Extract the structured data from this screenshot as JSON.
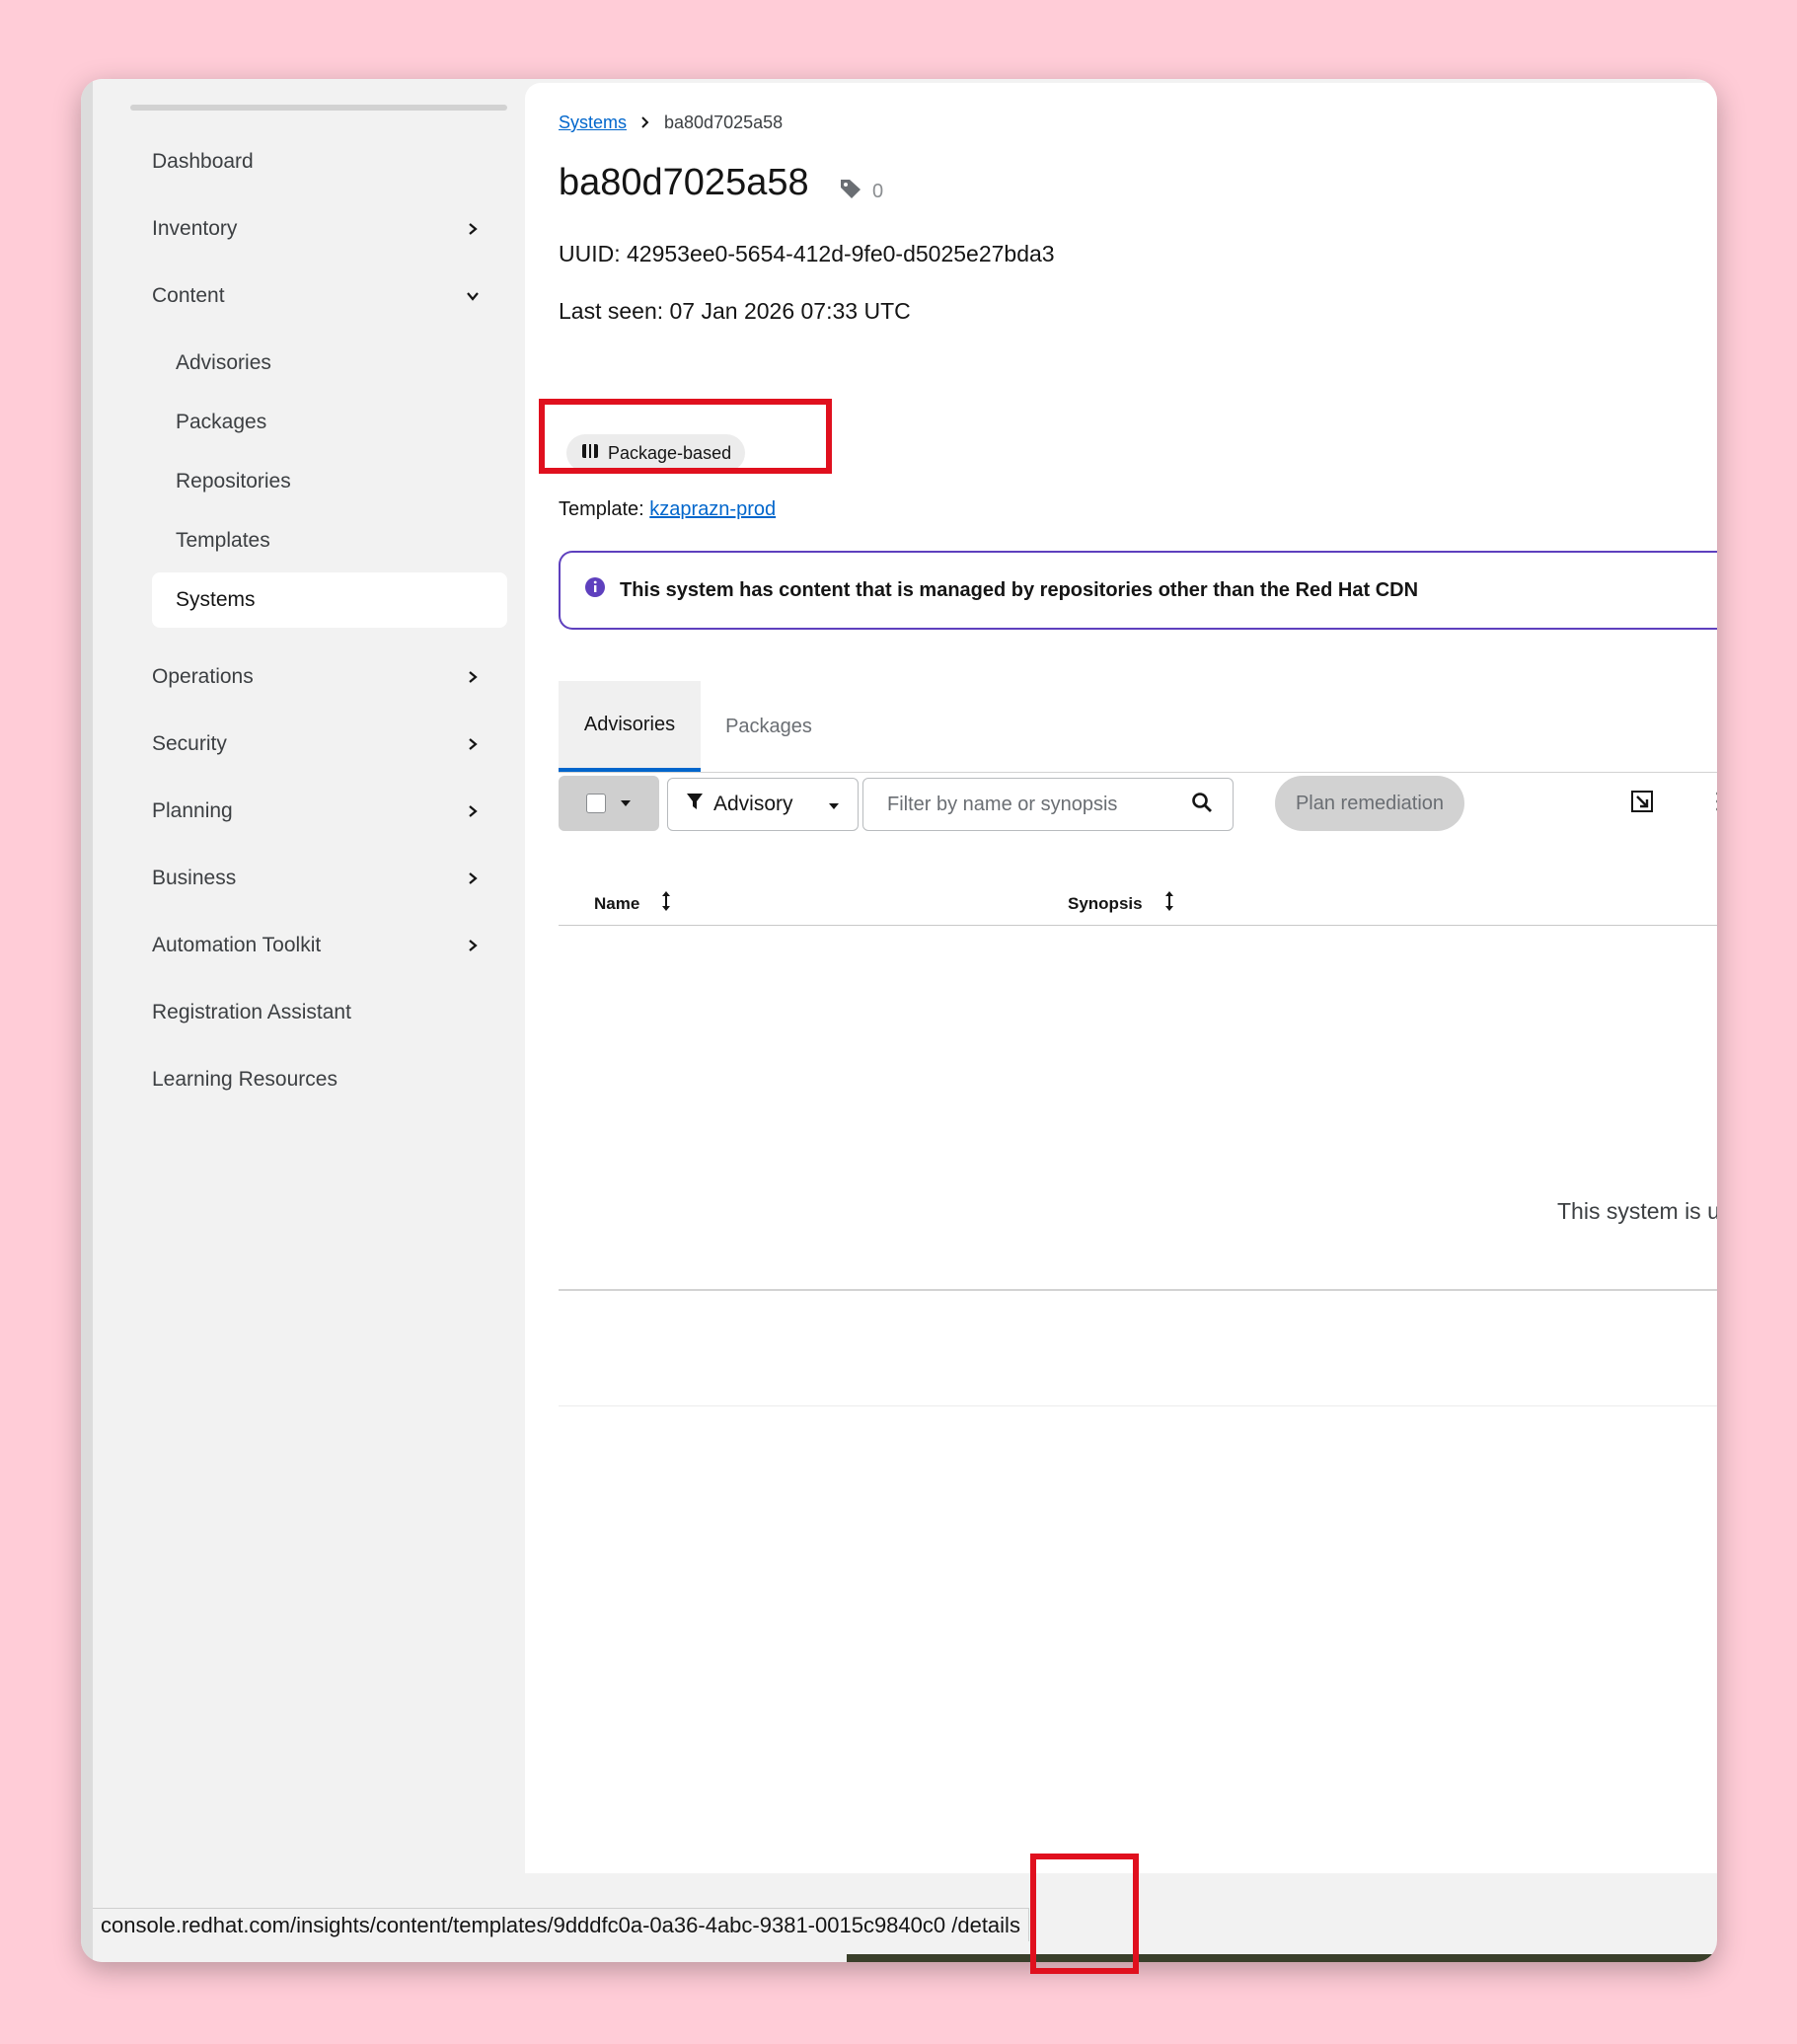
{
  "sidebar": {
    "items": [
      {
        "label": "Dashboard"
      },
      {
        "label": "Inventory"
      },
      {
        "label": "Content"
      },
      {
        "label": "Advisories"
      },
      {
        "label": "Packages"
      },
      {
        "label": "Repositories"
      },
      {
        "label": "Templates"
      },
      {
        "label": "Systems"
      },
      {
        "label": "Operations"
      },
      {
        "label": "Security"
      },
      {
        "label": "Planning"
      },
      {
        "label": "Business"
      },
      {
        "label": "Automation Toolkit"
      },
      {
        "label": "Registration Assistant"
      },
      {
        "label": "Learning Resources"
      }
    ]
  },
  "breadcrumb": {
    "parent": "Systems",
    "current": "ba80d7025a58"
  },
  "system": {
    "title": "ba80d7025a58",
    "tag_count": "0",
    "uuid": "UUID: 42953ee0-5654-412d-9fe0-d5025e27bda3",
    "last_seen": "Last seen: 07 Jan 2026 07:33 UTC",
    "type_label": "Package-based",
    "template_label": "Template:",
    "template_link": "kzaprazn-prod"
  },
  "alert": {
    "text": "This system has content that is managed by repositories other than the Red Hat CDN"
  },
  "tabs": [
    {
      "label": "Advisories"
    },
    {
      "label": "Packages"
    }
  ],
  "toolbar": {
    "filter_label": "Advisory",
    "search_placeholder": "Filter by name or synopsis",
    "plan_remediation": "Plan remediation"
  },
  "table": {
    "columns": [
      {
        "label": "Name"
      },
      {
        "label": "Synopsis"
      }
    ]
  },
  "empty_state": {
    "text": "This system is up to da"
  },
  "status_bar": {
    "url": "console.redhat.com/insights/content/templates/9dddfc0a-0a36-4abc-9381-0015c9840c0 /details"
  },
  "colors": {
    "accent": "#0066cc",
    "alert_border": "#5e40be",
    "highlight": "#e0101e",
    "background": "#ffccd7"
  }
}
